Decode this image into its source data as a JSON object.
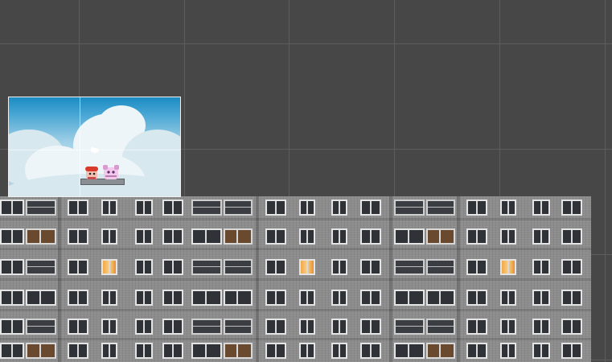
{
  "scene": {
    "background_color": "#474747",
    "grid_color": "#5d5d5d",
    "sprites": {
      "sky": "sky-clouds-background",
      "building": "apartment-building",
      "characters": [
        "character-red",
        "character-pink",
        "bird"
      ]
    }
  }
}
